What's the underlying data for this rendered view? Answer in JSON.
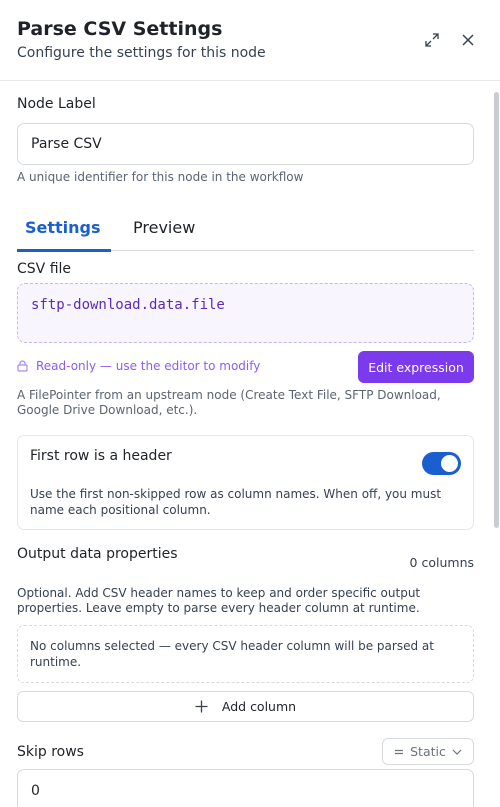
{
  "header": {
    "title": "Parse CSV Settings",
    "subtitle": "Configure the settings for this node",
    "expand_icon": "expand-icon",
    "close_icon": "close-icon"
  },
  "node_label": {
    "label": "Node Label",
    "value": "Parse CSV",
    "hint": "A unique identifier for this node in the workflow"
  },
  "tabs": [
    {
      "label": "Settings",
      "active": true
    },
    {
      "label": "Preview",
      "active": false
    }
  ],
  "csv_file": {
    "label": "CSV file",
    "expression": "sftp-download.data.file",
    "readonly_text": "Read-only — use the editor to modify",
    "edit_button": "Edit expression",
    "hint_line1": "A FilePointer from an upstream node (Create Text File, SFTP Download,",
    "hint_line2": "Google Drive Download, etc.)."
  },
  "header_row": {
    "title": "First row is a header",
    "enabled": true,
    "desc_line1": "Use the first non-skipped row as column names. When off, you must",
    "desc_line2": "name each positional column."
  },
  "output_props": {
    "label": "Output data properties",
    "count": "0 columns",
    "hint_line1": "Optional. Add CSV header names to keep and order specific output",
    "hint_line2": "properties. Leave empty to parse every header column at runtime.",
    "empty_line1": "No columns selected — every CSV header column will be parsed at",
    "empty_line2": "runtime.",
    "add_button": "Add column"
  },
  "skip_rows": {
    "label": "Skip rows",
    "mode": "Static",
    "value": "0"
  },
  "colors": {
    "accent_blue": "#1a5fd0",
    "accent_purple": "#7c3aed",
    "expression_text": "#5b2bb8"
  }
}
